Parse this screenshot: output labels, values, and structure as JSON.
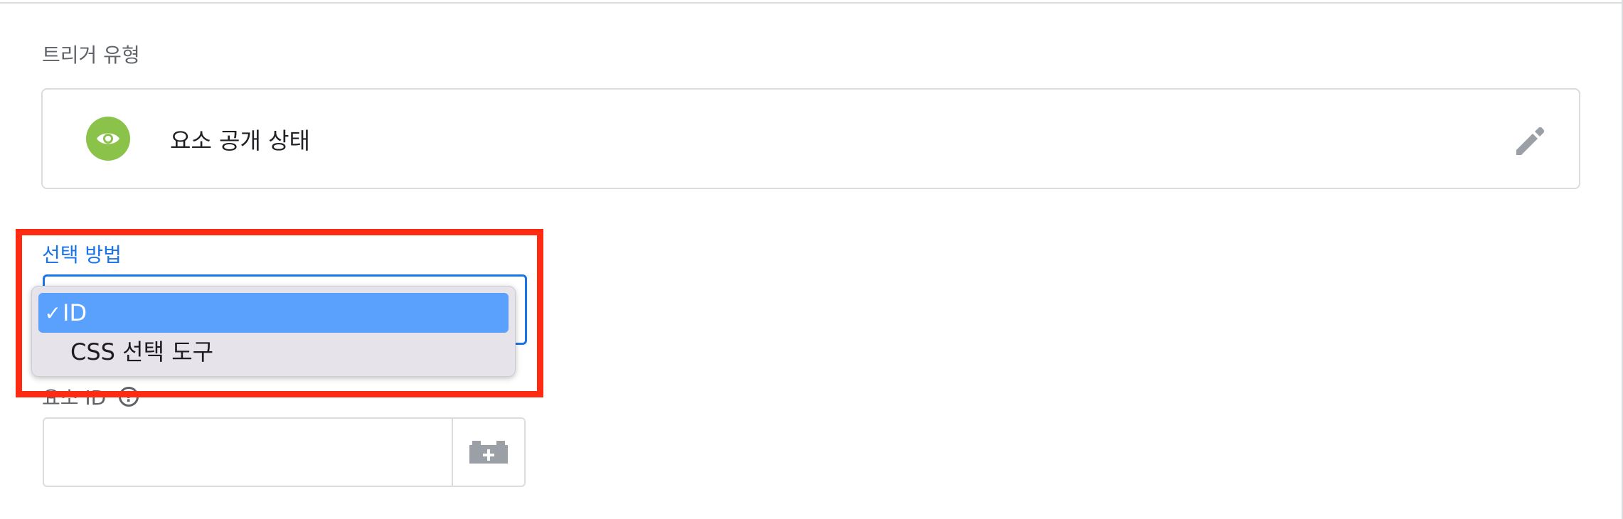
{
  "trigger_type": {
    "section_label": "트리거 유형",
    "name": "요소 공개 상태",
    "icon": "eye-icon",
    "icon_color": "#8bc34a"
  },
  "selection_method": {
    "label": "선택 방법",
    "selected_value": "ID",
    "options": [
      {
        "label": "ID",
        "selected": true,
        "check": "✓"
      },
      {
        "label": "CSS 선택 도구",
        "selected": false
      }
    ]
  },
  "element_id": {
    "label": "요소 ID",
    "help_icon": "help-icon",
    "value": "",
    "variable_button_icon": "variable-picker-icon"
  },
  "colors": {
    "accent": "#1a73e8",
    "highlight_border": "#ff2a12",
    "selected_option_bg": "#5aa0fd"
  }
}
